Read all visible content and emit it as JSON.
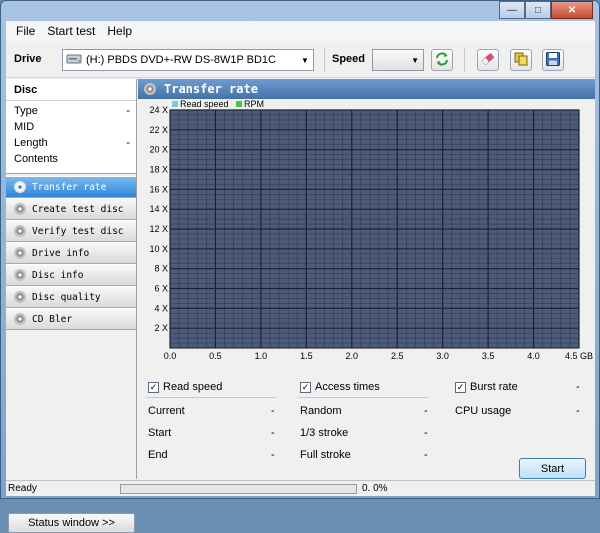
{
  "window": {
    "minimize_glyph": "—",
    "maximize_glyph": "□",
    "close_glyph": "✕"
  },
  "menu": [
    "File",
    "Start test",
    "Help"
  ],
  "toolbar": {
    "drive_label": "Drive",
    "drive_value": "(H:)  PBDS DVD+-RW DS-8W1P BD1C",
    "speed_label": "Speed",
    "speed_value": ""
  },
  "disc": {
    "header": "Disc",
    "rows": [
      {
        "label": "Type",
        "value": "-"
      },
      {
        "label": "MID",
        "value": ""
      },
      {
        "label": "Length",
        "value": "-"
      },
      {
        "label": "Contents",
        "value": ""
      }
    ]
  },
  "nav": [
    {
      "label": "Transfer rate",
      "active": true
    },
    {
      "label": "Create test disc",
      "active": false
    },
    {
      "label": "Verify test disc",
      "active": false
    },
    {
      "label": "Drive info",
      "active": false
    },
    {
      "label": "Disc info",
      "active": false
    },
    {
      "label": "Disc quality",
      "active": false
    },
    {
      "label": "CD Bler",
      "active": false
    }
  ],
  "status_window_button": "Status window >>",
  "panel": {
    "title": "Transfer rate"
  },
  "chart_data": {
    "type": "line",
    "series": [
      {
        "name": "Read speed",
        "values": [],
        "color": "#7ec8e3"
      },
      {
        "name": "RPM",
        "values": [],
        "color": "#49c449"
      }
    ],
    "x_ticks": [
      "0.0",
      "0.5",
      "1.0",
      "1.5",
      "2.0",
      "2.5",
      "3.0",
      "3.5",
      "4.0",
      "4.5 GB"
    ],
    "y_ticks": [
      "2 X",
      "4 X",
      "6 X",
      "8 X",
      "10 X",
      "12 X",
      "14 X",
      "16 X",
      "18 X",
      "20 X",
      "22 X",
      "24 X"
    ],
    "xlim": [
      0,
      4.5
    ],
    "ylim": [
      0,
      24
    ],
    "grid": true,
    "legend": "top-left",
    "background_color": "#4d5b78",
    "grid_color": "#1c2233"
  },
  "options": {
    "read_speed": {
      "label": "Read speed",
      "checked": true
    },
    "access_times": {
      "label": "Access times",
      "checked": true
    },
    "burst_rate": {
      "label": "Burst rate",
      "checked": true
    },
    "burst_value": "-",
    "cpu_label": "CPU usage",
    "cpu_value": "-",
    "read_stats": [
      {
        "label": "Current",
        "value": "-"
      },
      {
        "label": "Start",
        "value": "-"
      },
      {
        "label": "End",
        "value": "-"
      }
    ],
    "access_stats": [
      {
        "label": "Random",
        "value": "-"
      },
      {
        "label": "1/3 stroke",
        "value": "-"
      },
      {
        "label": "Full stroke",
        "value": "-"
      }
    ],
    "start_button": "Start",
    "check_glyph": "✓"
  },
  "statusbar": {
    "text": "Ready",
    "progress_fraction": 0,
    "percent": "0. 0%"
  }
}
